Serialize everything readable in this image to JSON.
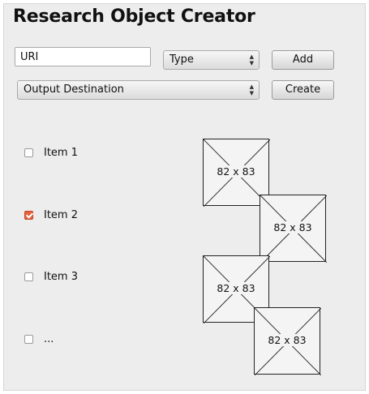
{
  "title": "Research Object Creator",
  "form": {
    "uri_value": "URI",
    "type_select": "Type",
    "add_label": "Add",
    "output_select": "Output Destination",
    "create_label": "Create"
  },
  "items": [
    {
      "label": "Item 1",
      "checked": false
    },
    {
      "label": "Item 2",
      "checked": true
    },
    {
      "label": "Item 3",
      "checked": false
    },
    {
      "label": "...",
      "checked": false
    }
  ],
  "images": [
    {
      "label": "82 x 83"
    },
    {
      "label": "82 x 83"
    },
    {
      "label": "82 x 83"
    },
    {
      "label": "82 x 83"
    }
  ],
  "colors": {
    "checked": "#e8603c"
  }
}
